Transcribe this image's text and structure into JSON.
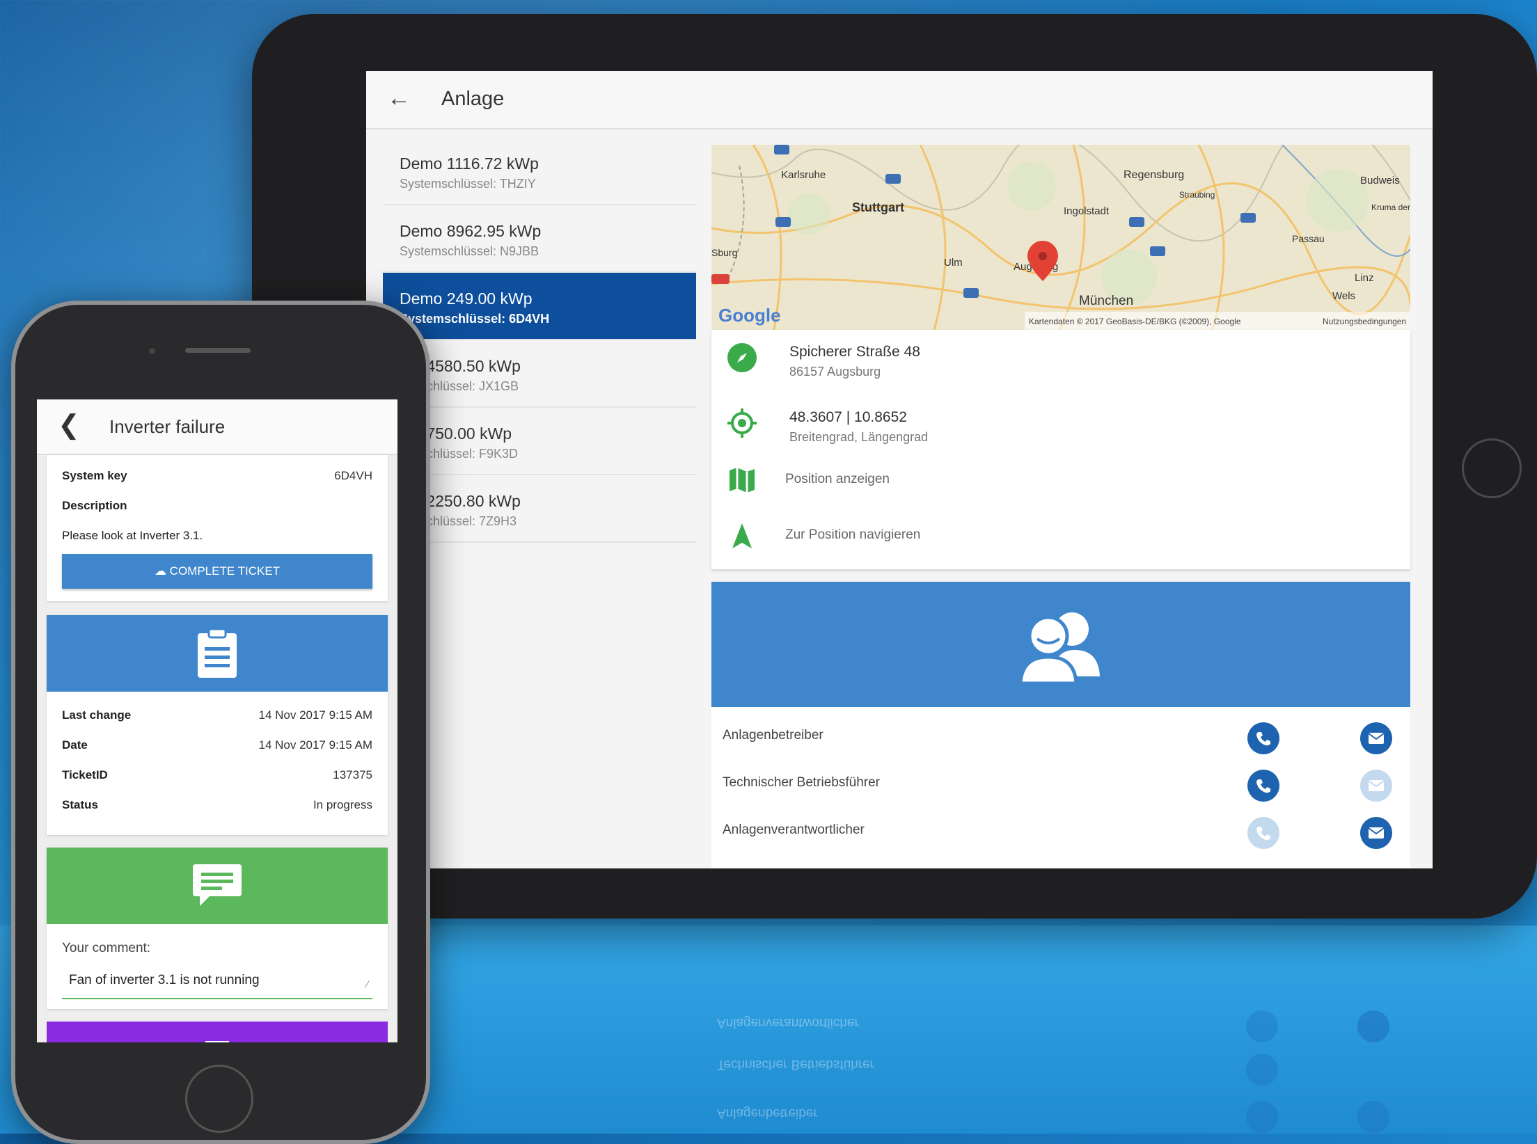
{
  "tablet": {
    "app_bar": {
      "back_icon": "arrow-left-icon",
      "title": "Anlage"
    },
    "systems": [
      {
        "name": "Demo 1116.72 kWp",
        "key": "Systemschlüssel: THZIY",
        "selected": false
      },
      {
        "name": "Demo 8962.95 kWp",
        "key": "Systemschlüssel: N9JBB",
        "selected": false
      },
      {
        "name": "Demo 249.00 kWp",
        "key": "Systemschlüssel: 6D4VH",
        "selected": true
      },
      {
        "name": "mo 4580.50 kWp",
        "key": "temschlüssel: JX1GB",
        "selected": false
      },
      {
        "name": "mo 750.00 kWp",
        "key": "temschlüssel: F9K3D",
        "selected": false
      },
      {
        "name": "mo 2250.80 kWp",
        "key": "temschlüssel: 7Z9H3",
        "selected": false
      }
    ],
    "map": {
      "cities": [
        "Karlsruhe",
        "Stuttgart",
        "Regensburg",
        "Ingolstadt",
        "Straubing",
        "Passau",
        "Ulm",
        "Augsburg",
        "München",
        "Linz",
        "Wels",
        "Budweis",
        "Kruma der Mc",
        "Sburg"
      ],
      "attribution": "Kartendaten © 2017 GeoBasis-DE/BKG (©2009), Google",
      "terms": "Nutzungsbedingungen",
      "logo": "Google"
    },
    "address": {
      "street": "Spicherer Straße 48",
      "city": "86157 Augsburg"
    },
    "coordinates": {
      "value": "48.3607 | 10.8652",
      "label": "Breitengrad, Längengrad"
    },
    "actions": {
      "show_position": "Position anzeigen",
      "navigate": "Zur Position navigieren"
    },
    "contacts": [
      {
        "role": "Anlagenbetreiber",
        "phone_enabled": true,
        "mail_enabled": true
      },
      {
        "role": "Technischer Betriebsführer",
        "phone_enabled": true,
        "mail_enabled": false
      },
      {
        "role": "Anlagenverantwortlicher",
        "phone_enabled": false,
        "mail_enabled": true
      }
    ],
    "colors": {
      "primary": "#0d4f9c",
      "accent_blue": "#3f86cc",
      "green_icon": "#3aaa4a"
    }
  },
  "phone": {
    "app_bar": {
      "back_icon": "chevron-left-icon",
      "title": "Inverter failure"
    },
    "ticket": {
      "system_key_label": "System key",
      "system_key": "6D4VH",
      "description_label": "Description",
      "description": "Please look at Inverter 3.1.",
      "complete_button": "COMPLETE TICKET"
    },
    "details": {
      "last_change_label": "Last change",
      "last_change": "14 Nov 2017 9:15 AM",
      "date_label": "Date",
      "date": "14 Nov 2017 9:15 AM",
      "ticket_id_label": "TicketID",
      "ticket_id": "137375",
      "status_label": "Status",
      "status": "In progress"
    },
    "comment": {
      "label": "Your comment:",
      "value": "Fan of inverter 3.1 is not running"
    },
    "colors": {
      "blue": "#3f86cc",
      "green": "#5cb85c",
      "purple": "#8a2be2"
    }
  }
}
